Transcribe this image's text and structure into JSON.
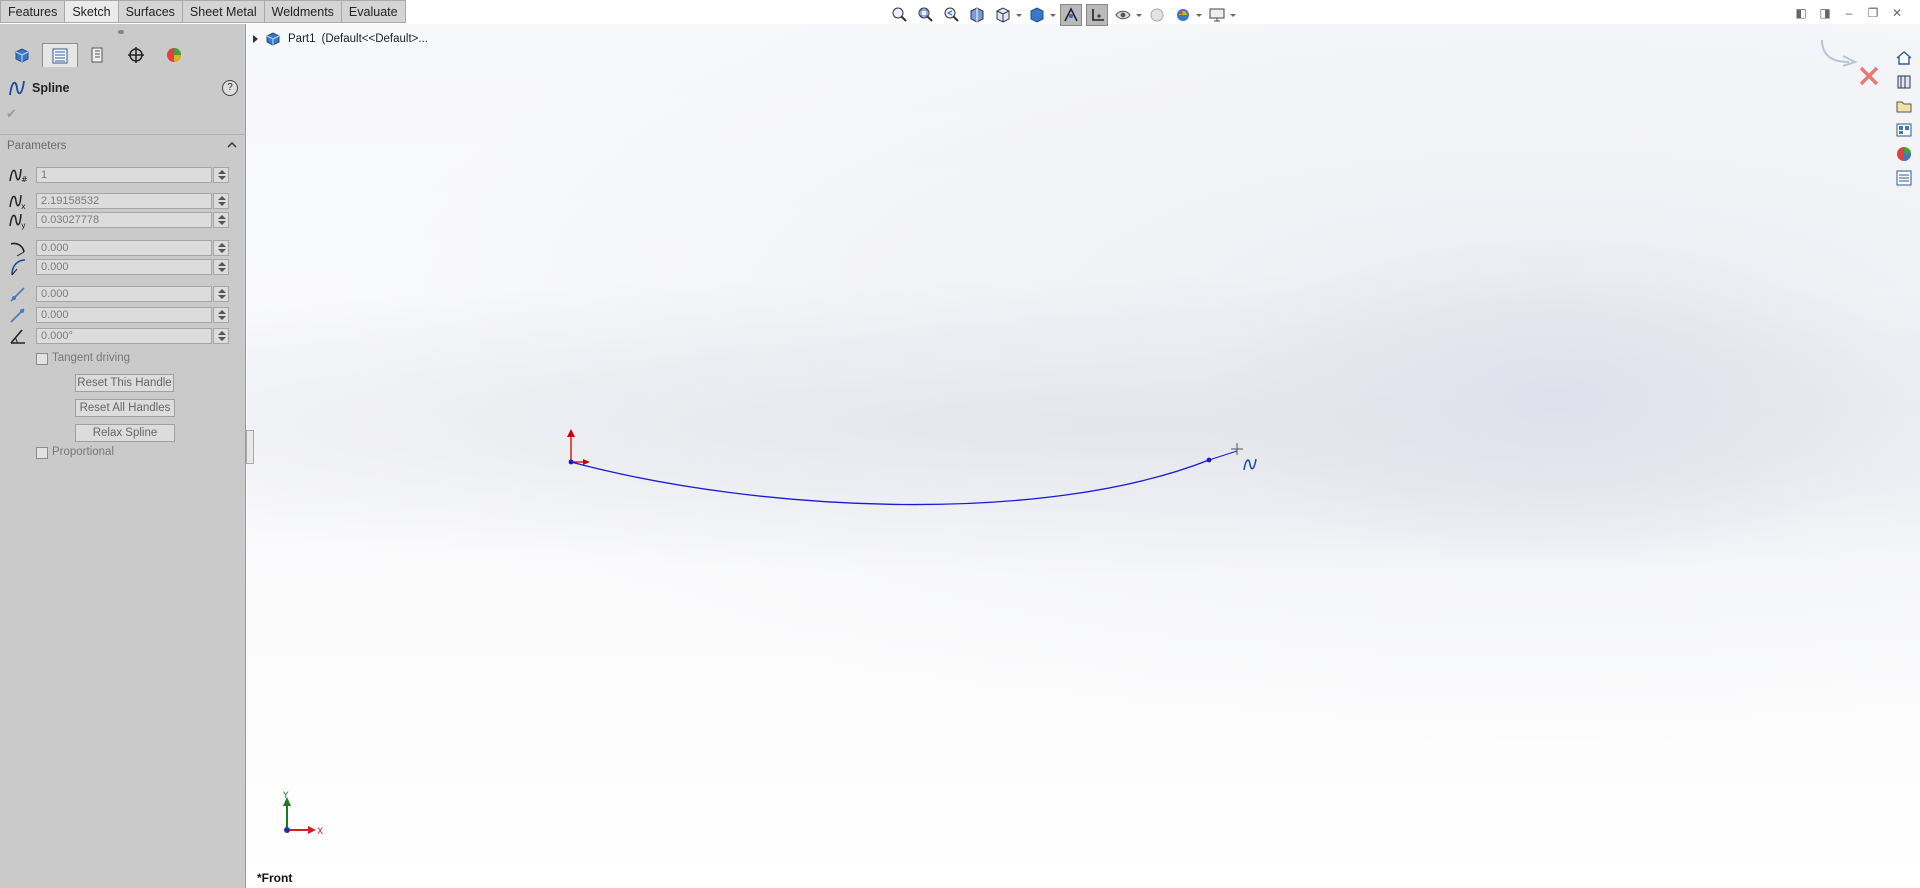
{
  "tabs": [
    {
      "label": "Features"
    },
    {
      "label": "Sketch",
      "active": true
    },
    {
      "label": "Surfaces"
    },
    {
      "label": "Sheet Metal"
    },
    {
      "label": "Weldments"
    },
    {
      "label": "Evaluate"
    }
  ],
  "property_manager": {
    "title": "Spline",
    "help": "?",
    "group_title": "Parameters",
    "fields": [
      {
        "value": "1",
        "icon": "spline-point-number-icon"
      },
      {
        "value": "2.19158532",
        "icon": "spline-x-coordinate-icon"
      },
      {
        "value": "0.03027778",
        "icon": "spline-y-coordinate-icon"
      },
      {
        "value": "0.000",
        "icon": "curvature-radius-icon"
      },
      {
        "value": "0.000",
        "icon": "curvature-icon"
      },
      {
        "value": "0.000",
        "icon": "tangent-weight-left-icon"
      },
      {
        "value": "0.000",
        "icon": "tangent-weight-right-icon"
      },
      {
        "value": "0.000°",
        "icon": "tangent-direction-icon"
      }
    ],
    "tangent_driving": "Tangent driving",
    "reset_this_handle": "Reset This Handle",
    "reset_all_handles": "Reset All Handles",
    "relax_spline": "Relax Spline",
    "proportional": "Proportional"
  },
  "tree": {
    "part": "Part1",
    "config": "(Default<<Default>..."
  },
  "view_label": "*Front",
  "axis": {
    "x": "X",
    "y": "Y"
  },
  "colors": {
    "spline": "#1a1ad6",
    "origin_arrow": "#cc0000",
    "axis_y": "#1f7a1f",
    "axis_x": "#d42020"
  }
}
